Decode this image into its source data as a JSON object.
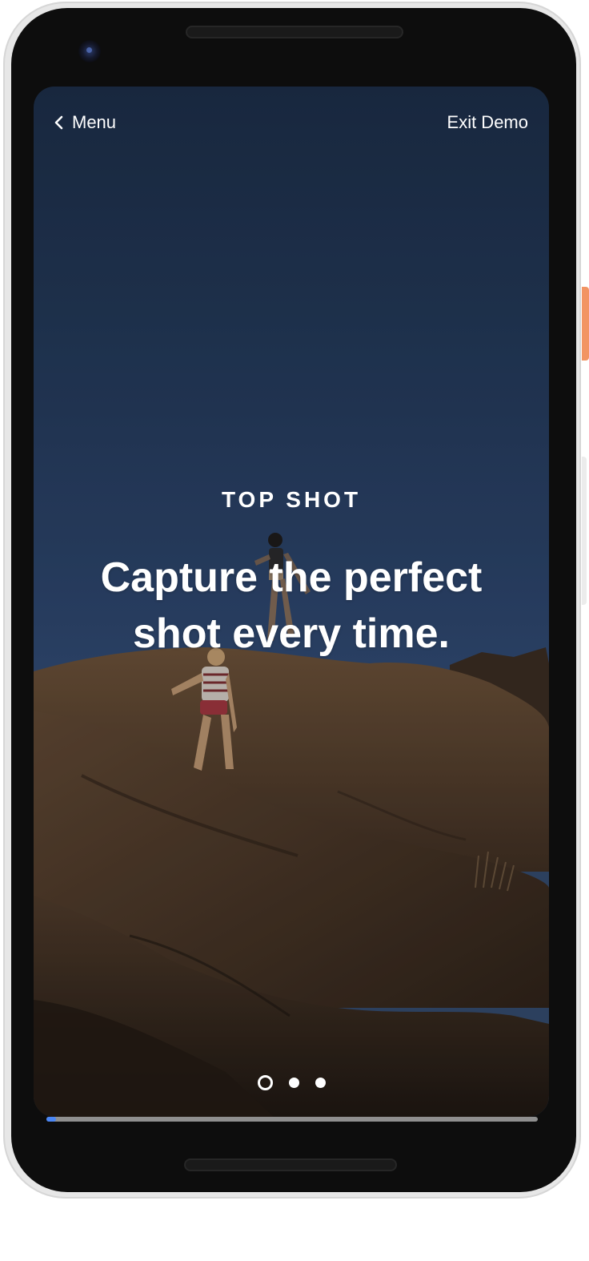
{
  "header": {
    "back_label": "Menu",
    "exit_label": "Exit Demo"
  },
  "feature": {
    "eyebrow": "TOP SHOT",
    "headline_line1": "Capture the perfect",
    "headline_line2": "shot every time."
  },
  "pager": {
    "total": 3,
    "active_index": 0
  },
  "progress": {
    "fraction": 0.02
  },
  "icons": {
    "back": "chevron-left-icon"
  },
  "colors": {
    "sky": "#2a4166",
    "rock": "#5a4432",
    "progress_accent": "#4a86f5",
    "side_button": "#f29463"
  }
}
